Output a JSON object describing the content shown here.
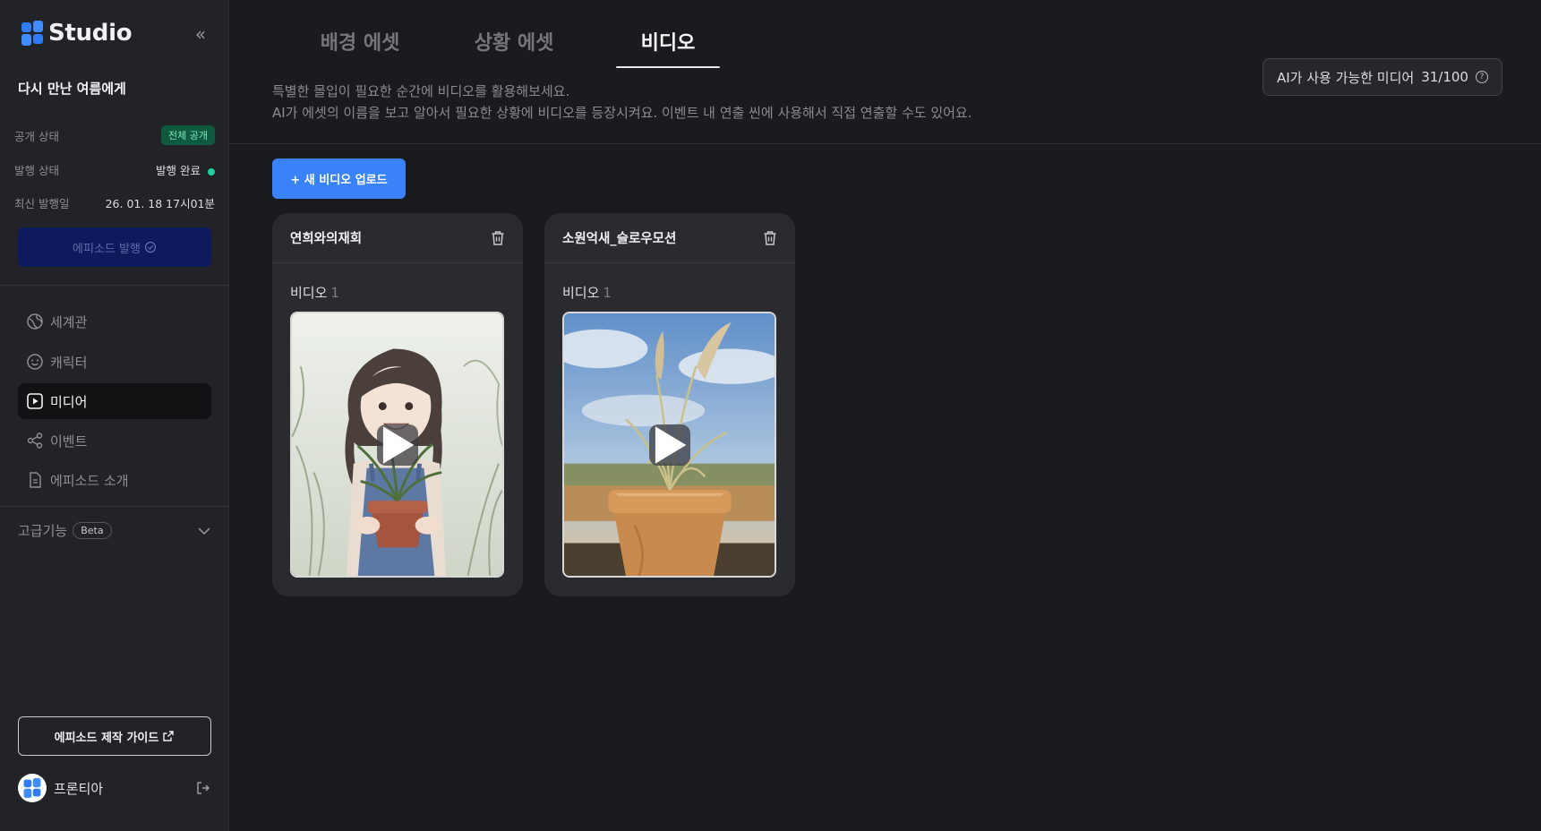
{
  "sidebar": {
    "brand": "Studio",
    "collapse_icon": "double-chevron-left-icon",
    "project_title": "다시 만난 여름에게",
    "meta": {
      "visibility_label": "공개 상태",
      "visibility_value": "전체 공개",
      "publish_label": "발행 상태",
      "publish_value": "발행 완료",
      "latest_label": "최신 발행일",
      "latest_value": "26. 01. 18 17시01분"
    },
    "publish_button": "에피소드 발행",
    "nav": [
      {
        "label": "세계관",
        "icon": "globe-icon"
      },
      {
        "label": "캐릭터",
        "icon": "smile-icon"
      },
      {
        "label": "미디어",
        "icon": "play-square-icon"
      },
      {
        "label": "이벤트",
        "icon": "share-nodes-icon"
      },
      {
        "label": "에피소드 소개",
        "icon": "document-icon"
      }
    ],
    "active_nav": "미디어",
    "advanced_label": "고급기능",
    "beta_label": "Beta",
    "guide_button": "에피소드 제작 가이드",
    "user_name": "프론티아"
  },
  "main": {
    "tabs": [
      {
        "label": "배경 에셋"
      },
      {
        "label": "상황 에셋"
      },
      {
        "label": "비디오"
      }
    ],
    "active_tab": "비디오",
    "description_line1": "특별한 몰입이 필요한 순간에 비디오를 활용해보세요.",
    "description_line2": "AI가 에셋의 이름을 보고 알아서 필요한 상황에 비디오를 등장시켜요. 이벤트 내 연출 씬에 사용해서 직접 연출할 수도 있어요.",
    "quota_label": "AI가 사용 가능한 미디어",
    "quota_value": "31/100",
    "upload_button": "+ 새 비디오 업로드",
    "cards": [
      {
        "title": "연희와의재회",
        "sub_label": "비디오",
        "count": "1"
      },
      {
        "title": "소원억새_슬로우모션",
        "sub_label": "비디오",
        "count": "1"
      }
    ]
  },
  "colors": {
    "background": "#1a1b1e",
    "sidebar": "#222327",
    "accent_blue": "#3a82f7",
    "status_green": "#21d19f",
    "publish_button_bg": "#0d1a5c"
  }
}
